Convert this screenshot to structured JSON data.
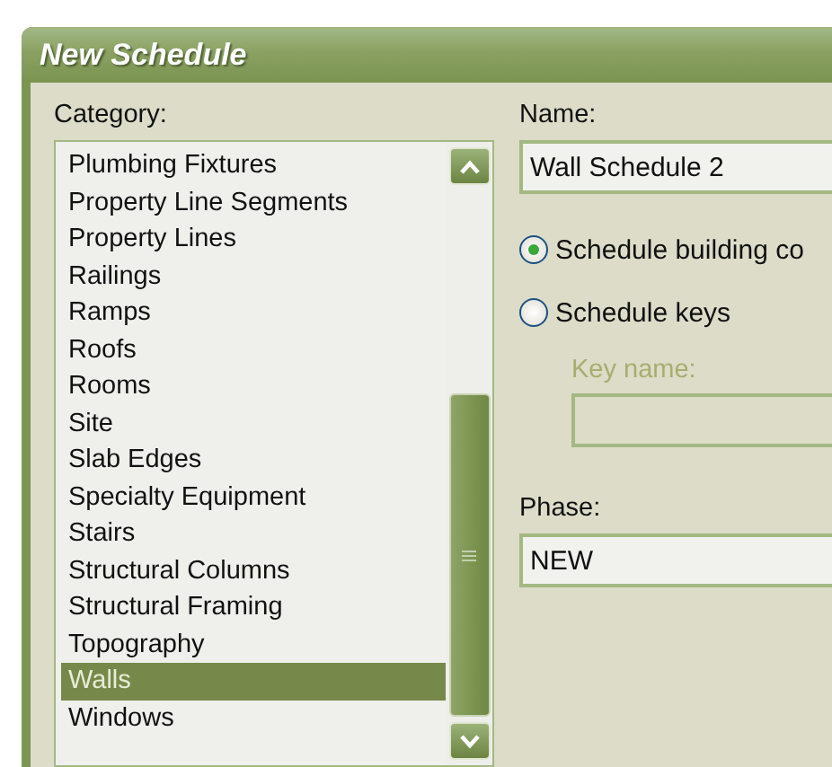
{
  "window": {
    "title": "New Schedule"
  },
  "category": {
    "label": "Category:",
    "items": [
      {
        "label": "Plumbing Fixtures",
        "selected": false
      },
      {
        "label": "Property Line Segments",
        "selected": false
      },
      {
        "label": "Property Lines",
        "selected": false
      },
      {
        "label": "Railings",
        "selected": false
      },
      {
        "label": "Ramps",
        "selected": false
      },
      {
        "label": "Roofs",
        "selected": false
      },
      {
        "label": "Rooms",
        "selected": false
      },
      {
        "label": "Site",
        "selected": false
      },
      {
        "label": "Slab Edges",
        "selected": false
      },
      {
        "label": "Specialty Equipment",
        "selected": false
      },
      {
        "label": "Stairs",
        "selected": false
      },
      {
        "label": "Structural Columns",
        "selected": false
      },
      {
        "label": "Structural Framing",
        "selected": false
      },
      {
        "label": "Topography",
        "selected": false
      },
      {
        "label": "Walls",
        "selected": true
      },
      {
        "label": "Windows",
        "selected": false
      }
    ]
  },
  "name": {
    "label": "Name:",
    "value": "Wall Schedule 2"
  },
  "schedule_type": [
    {
      "label": "Schedule building co",
      "selected": true
    },
    {
      "label": "Schedule keys",
      "selected": false
    }
  ],
  "key_name": {
    "label": "Key name:",
    "disabled": true
  },
  "phase": {
    "label": "Phase:",
    "value": "NEW"
  }
}
